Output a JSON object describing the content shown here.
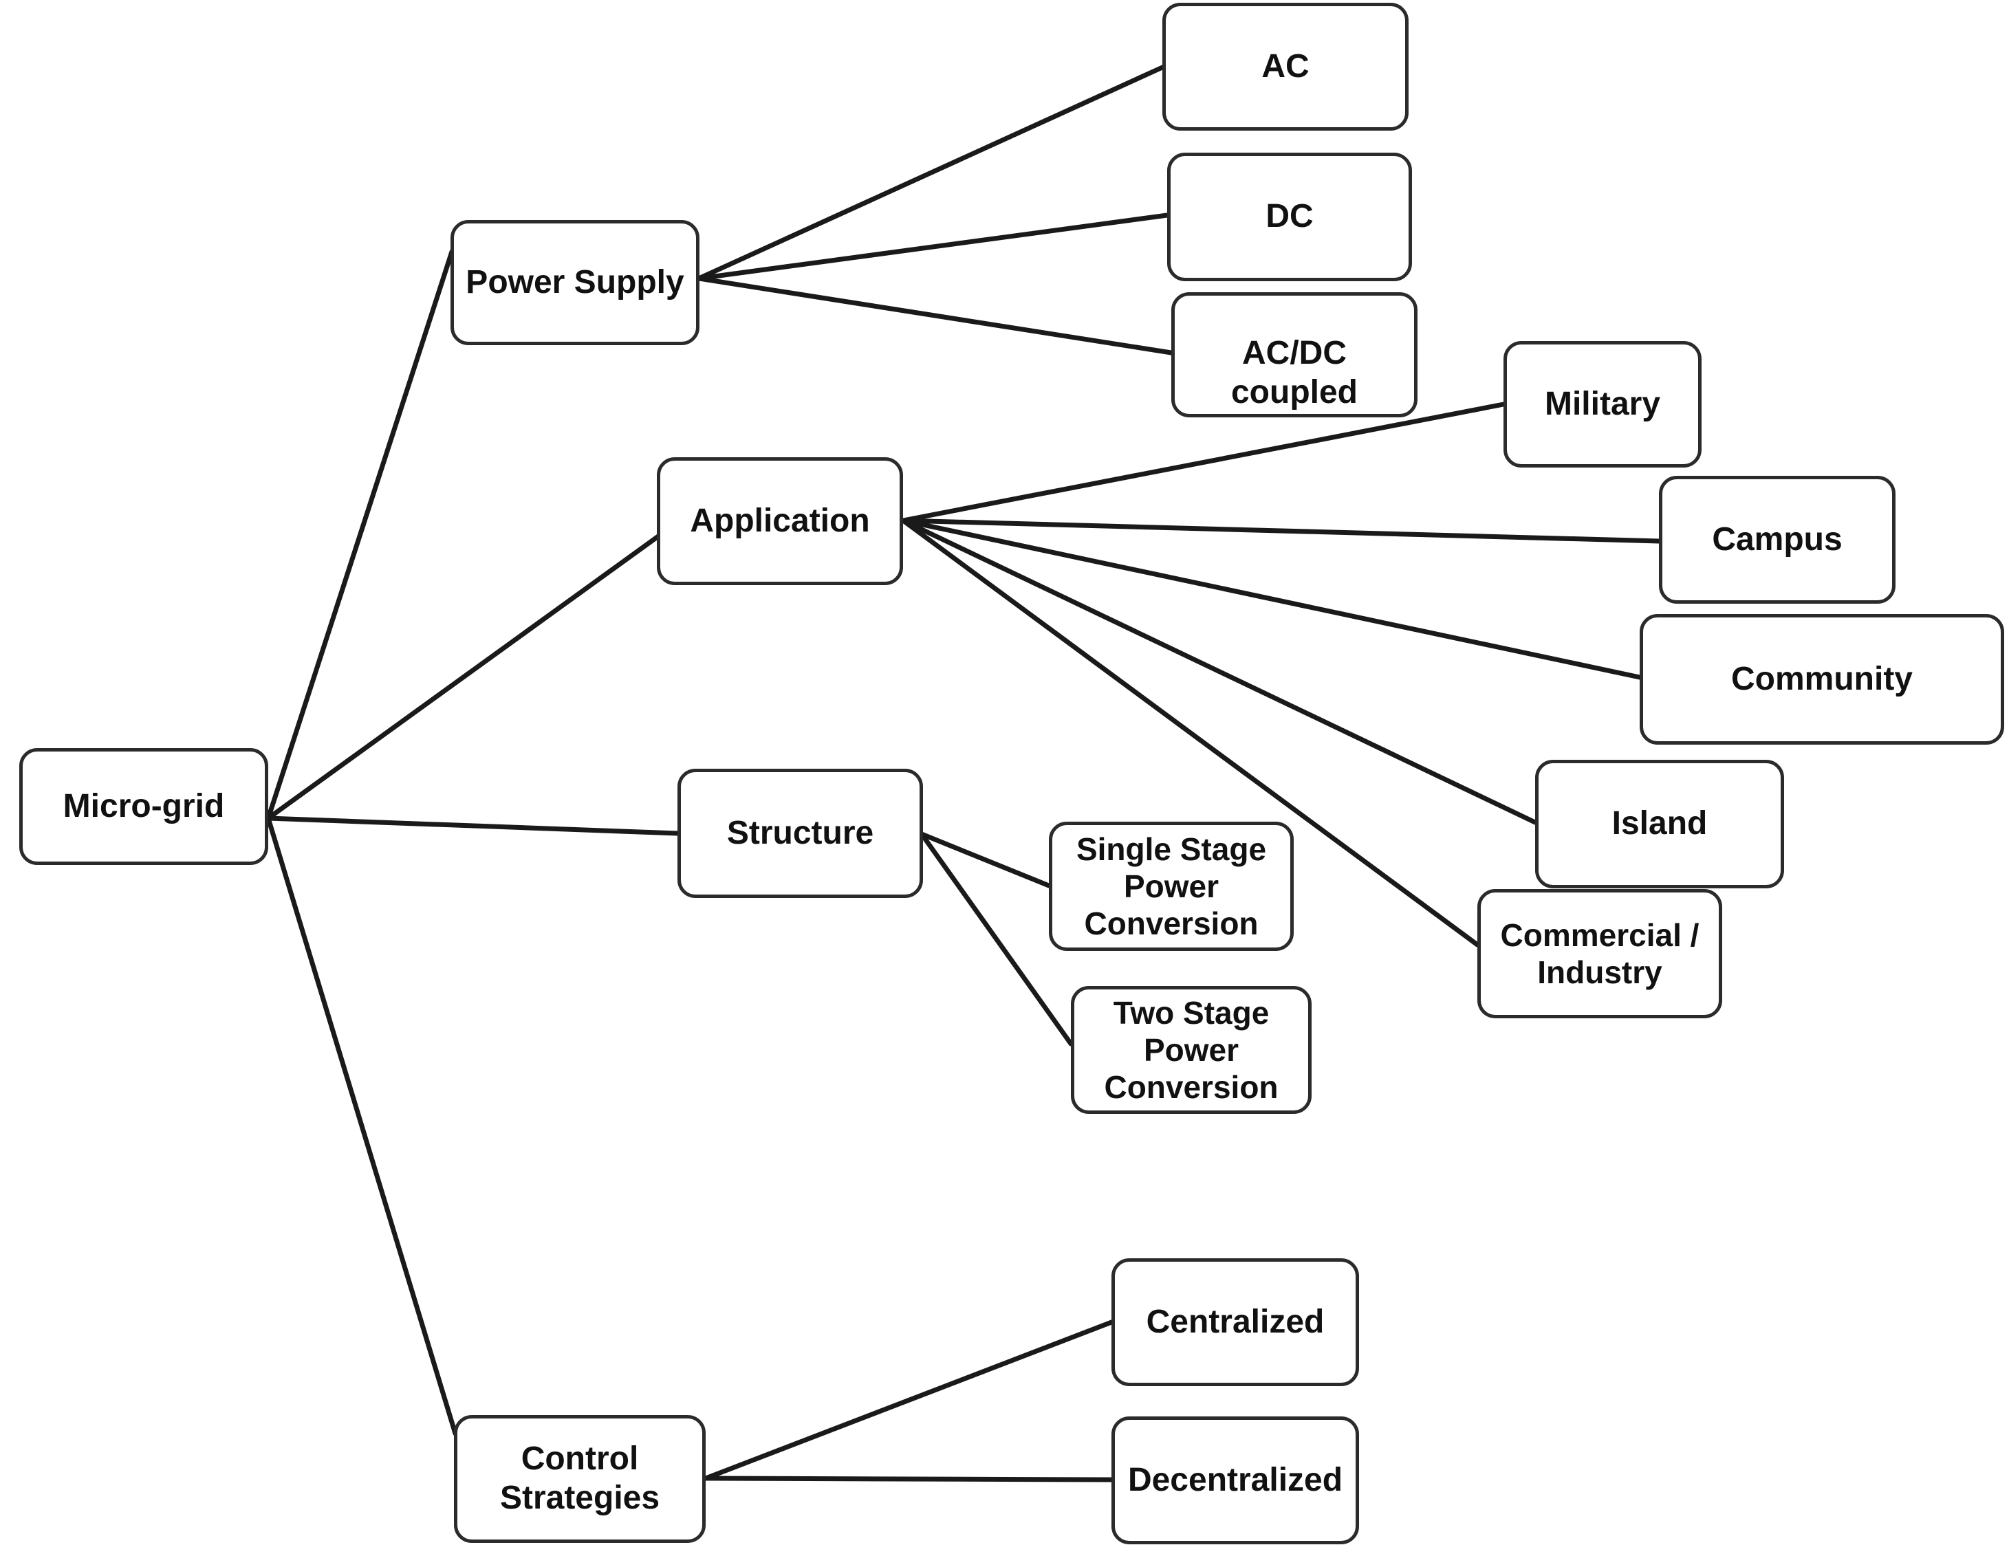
{
  "diagram": {
    "type": "tree",
    "root": "Micro-grid",
    "nodes": {
      "micro_grid": "Micro-grid",
      "power_supply": "Power Supply",
      "ac": "AC",
      "dc": "DC",
      "ac_dc_coupled": "AC/DC coupled",
      "application": "Application",
      "military": "Military",
      "campus": "Campus",
      "community": "Community",
      "island": "Island",
      "commercial_industry": "Commercial /\nIndustry",
      "structure": "Structure",
      "single_stage": "Single Stage\nPower\nConversion",
      "two_stage": "Two Stage\nPower\nConversion",
      "control_strategies": "Control\nStrategies",
      "centralized": "Centralized",
      "decentralized": "Decentralized"
    },
    "edges": [
      {
        "from": "micro_grid",
        "to": "power_supply"
      },
      {
        "from": "micro_grid",
        "to": "application"
      },
      {
        "from": "micro_grid",
        "to": "structure"
      },
      {
        "from": "micro_grid",
        "to": "control_strategies"
      },
      {
        "from": "power_supply",
        "to": "ac"
      },
      {
        "from": "power_supply",
        "to": "dc"
      },
      {
        "from": "power_supply",
        "to": "ac_dc_coupled"
      },
      {
        "from": "application",
        "to": "military"
      },
      {
        "from": "application",
        "to": "campus"
      },
      {
        "from": "application",
        "to": "community"
      },
      {
        "from": "application",
        "to": "island"
      },
      {
        "from": "application",
        "to": "commercial_industry"
      },
      {
        "from": "structure",
        "to": "single_stage"
      },
      {
        "from": "structure",
        "to": "two_stage"
      },
      {
        "from": "control_strategies",
        "to": "centralized"
      },
      {
        "from": "control_strategies",
        "to": "decentralized"
      }
    ],
    "colors": {
      "node_border": "#2b2b2b",
      "node_fill": "#ffffff",
      "edge": "#1a1a1a",
      "text": "#111111",
      "background": "#ffffff"
    }
  }
}
